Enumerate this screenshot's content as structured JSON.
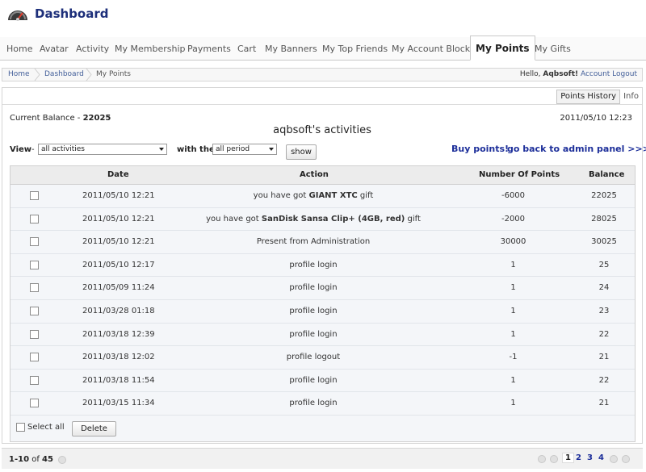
{
  "app": {
    "title": "Dashboard",
    "icon": "speedometer-icon"
  },
  "tabs": [
    {
      "label": "Home"
    },
    {
      "label": "Avatar"
    },
    {
      "label": "Activity"
    },
    {
      "label": "My Membership"
    },
    {
      "label": "Payments"
    },
    {
      "label": "Cart"
    },
    {
      "label": "My Banners"
    },
    {
      "label": "My Top Friends"
    },
    {
      "label": "My Account Blocks"
    },
    {
      "label": "My Points"
    },
    {
      "label": "My Gifts"
    }
  ],
  "breadcrumb": [
    "Home",
    "Dashboard",
    "My Points"
  ],
  "user": {
    "hello": "Hello,",
    "name": "Aqbsoft!",
    "logout": "Account Logout"
  },
  "panel": {
    "points_history": "Points History",
    "info": "Info",
    "balance_label": "Current Balance - ",
    "balance_value": "22025",
    "date_now": "2011/05/10 12:23",
    "title": "aqbsoft's activities"
  },
  "filters": {
    "view_label": "View",
    "view_dash": "-",
    "view_value": "all activities",
    "with_label": "with the",
    "period_value": "all period",
    "show_button": "show",
    "buy_points": "Buy points!",
    "admin_panel": "go back to admin panel >>>"
  },
  "table": {
    "headers": {
      "date": "Date",
      "action": "Action",
      "points": "Number Of Points",
      "balance": "Balance"
    },
    "rows": [
      {
        "date": "2011/05/10 12:21",
        "action_pre": "you have got ",
        "action_bold": "GIANT XTC",
        "action_post": " gift",
        "points": "-6000",
        "balance": "22025"
      },
      {
        "date": "2011/05/10 12:21",
        "action_pre": "you have got ",
        "action_bold": "SanDisk Sansa Clip+ (4GB, red)",
        "action_post": " gift",
        "points": "-2000",
        "balance": "28025"
      },
      {
        "date": "2011/05/10 12:21",
        "action_pre": "Present from Administration",
        "action_bold": "",
        "action_post": "",
        "points": "30000",
        "balance": "30025"
      },
      {
        "date": "2011/05/10 12:17",
        "action_pre": "profile login",
        "action_bold": "",
        "action_post": "",
        "points": "1",
        "balance": "25"
      },
      {
        "date": "2011/05/09 11:24",
        "action_pre": "profile login",
        "action_bold": "",
        "action_post": "",
        "points": "1",
        "balance": "24"
      },
      {
        "date": "2011/03/28 01:18",
        "action_pre": "profile login",
        "action_bold": "",
        "action_post": "",
        "points": "1",
        "balance": "23"
      },
      {
        "date": "2011/03/18 12:39",
        "action_pre": "profile login",
        "action_bold": "",
        "action_post": "",
        "points": "1",
        "balance": "22"
      },
      {
        "date": "2011/03/18 12:02",
        "action_pre": "profile logout",
        "action_bold": "",
        "action_post": "",
        "points": "-1",
        "balance": "21"
      },
      {
        "date": "2011/03/18 11:54",
        "action_pre": "profile login",
        "action_bold": "",
        "action_post": "",
        "points": "1",
        "balance": "22"
      },
      {
        "date": "2011/03/15 11:34",
        "action_pre": "profile login",
        "action_bold": "",
        "action_post": "",
        "points": "1",
        "balance": "21"
      }
    ],
    "select_all": "Select all",
    "delete_button": "Delete"
  },
  "footer": {
    "range": "1-10",
    "of": "of",
    "total": "45",
    "pages": [
      "1",
      "2",
      "3",
      "4"
    ],
    "current_page": "1"
  },
  "colors": {
    "accent": "#1d2f7a",
    "link": "#1d2f9a",
    "row_bg": "#f4f6f9"
  }
}
